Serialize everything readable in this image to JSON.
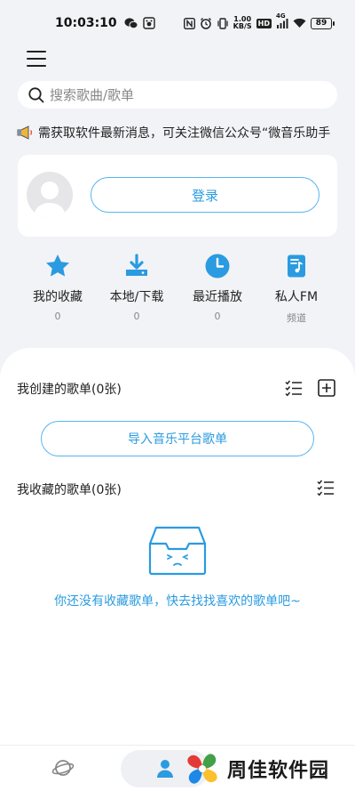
{
  "status_bar": {
    "time": "10:03:10",
    "net_speed_value": "1.00",
    "net_speed_unit": "KB/S",
    "hd": "HD",
    "signal": "4G",
    "battery": "89",
    "icons": [
      "wechat-icon",
      "baidu-icon",
      "nfc-icon",
      "alarm-icon",
      "vibrate-icon",
      "hd-icon",
      "signal-icon",
      "wifi-icon",
      "battery-icon"
    ]
  },
  "search": {
    "placeholder": "搜索歌曲/歌单"
  },
  "notice": {
    "text": "需获取软件最新消息，可关注微信公众号“微音乐助手"
  },
  "user": {
    "login_label": "登录"
  },
  "quick_actions": [
    {
      "label": "我的收藏",
      "count": "0",
      "icon": "star-icon"
    },
    {
      "label": "本地/下载",
      "count": "0",
      "icon": "download-icon"
    },
    {
      "label": "最近播放",
      "count": "0",
      "icon": "clock-icon"
    },
    {
      "label": "私人FM",
      "count": "频道",
      "icon": "music-note-icon"
    }
  ],
  "created_playlists": {
    "title": "我创建的歌单(0张)",
    "import_label": "导入音乐平台歌单"
  },
  "collected_playlists": {
    "title": "我收藏的歌单(0张)",
    "empty_text": "你还没有收藏歌单，快去找找喜欢的歌单吧~"
  },
  "watermark": {
    "text": "周佳软件园"
  },
  "colors": {
    "accent": "#2a9be0",
    "accent_light": "#55b6f2",
    "background": "#f2f3f7"
  }
}
